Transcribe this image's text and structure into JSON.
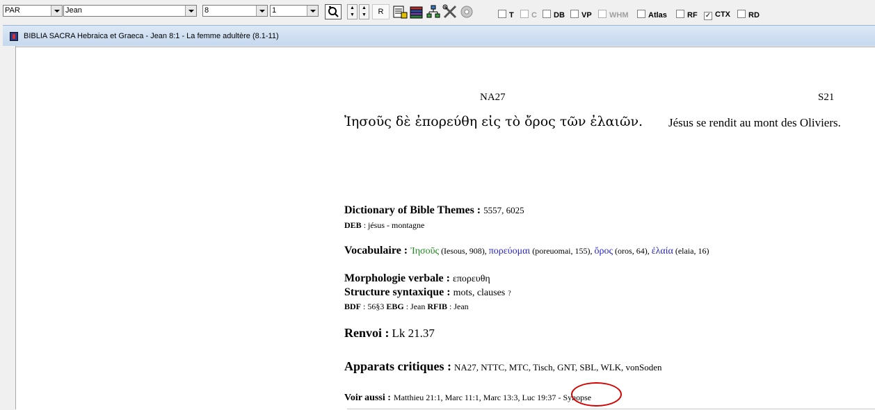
{
  "toolbar": {
    "combo_version": "PAR",
    "combo_book": "Jean",
    "combo_chapter": "8",
    "combo_verse": "1",
    "r_button": "R",
    "checkboxes": [
      {
        "label": "T",
        "checked": false,
        "enabled": true
      },
      {
        "label": "C",
        "checked": false,
        "enabled": false
      },
      {
        "label": "DB",
        "checked": false,
        "enabled": true
      },
      {
        "label": "VP",
        "checked": false,
        "enabled": true
      },
      {
        "label": "WHM",
        "checked": false,
        "enabled": false
      },
      {
        "label": "Atlas",
        "checked": false,
        "enabled": true
      },
      {
        "label": "RF",
        "checked": true,
        "enabled": true
      },
      {
        "label": "CTX",
        "checked": false,
        "enabled": true
      },
      {
        "label": "RD",
        "checked": false,
        "enabled": true
      }
    ]
  },
  "window": {
    "title": "BIBLIA SACRA Hebraica et Graeca - Jean 8:1 - La femme adultère (8.1-11)"
  },
  "content": {
    "header_left": "NA27",
    "header_right": "S21",
    "greek_text": "Ἰησοῦς δὲ ἐπορεύθη εἰς τὸ ὄρος τῶν ἐλαιῶν.",
    "french_text": "Jésus se rendit au mont des Oliviers.",
    "dbt_label": "Dictionary of Bible Themes :",
    "dbt_values": "5557, 6025",
    "deb_label": "DEB",
    "deb_values": " : jésus - montagne",
    "vocab_label": "Vocabulaire :",
    "vocab_items": [
      {
        "word": "Ἰησοῦς",
        "info": " (Iesous, 908), ",
        "color": "#1e8a1e"
      },
      {
        "word": "πορεύομαι",
        "info": " (poreuomai, 155), ",
        "color": "#2323c8"
      },
      {
        "word": "ὄρος",
        "info": " (oros, 64), ",
        "color": "#2323c8"
      },
      {
        "word": "ἐλαία",
        "info": " (elaia, 16)",
        "color": "#2323c8"
      }
    ],
    "morph_label": "Morphologie verbale :",
    "morph_value": "επορευθη",
    "struct_label": "Structure syntaxique :",
    "struct_value": "mots, clauses",
    "struct_suffix": "?",
    "bdf_line_label1": "BDF",
    "bdf_line_val1": " : 56§3 ",
    "bdf_line_label2": "EBG",
    "bdf_line_val2": " : Jean ",
    "bdf_line_label3": "RFIB",
    "bdf_line_val3": " : Jean",
    "renvoi_label": "Renvoi :",
    "renvoi_value": "Lk 21.37",
    "apparats_label": "Apparats critiques :",
    "apparats_value": "NA27, NTTC, MTC, Tisch, GNT, SBL, WLK, vonSoden",
    "voir_label": "Voir aussi :",
    "voir_value": "Matthieu 21:1, Marc 11:1, Marc 13:3, Luc 19:37",
    "synopse_prefix": " - ",
    "synopse_link": "Synopse"
  }
}
